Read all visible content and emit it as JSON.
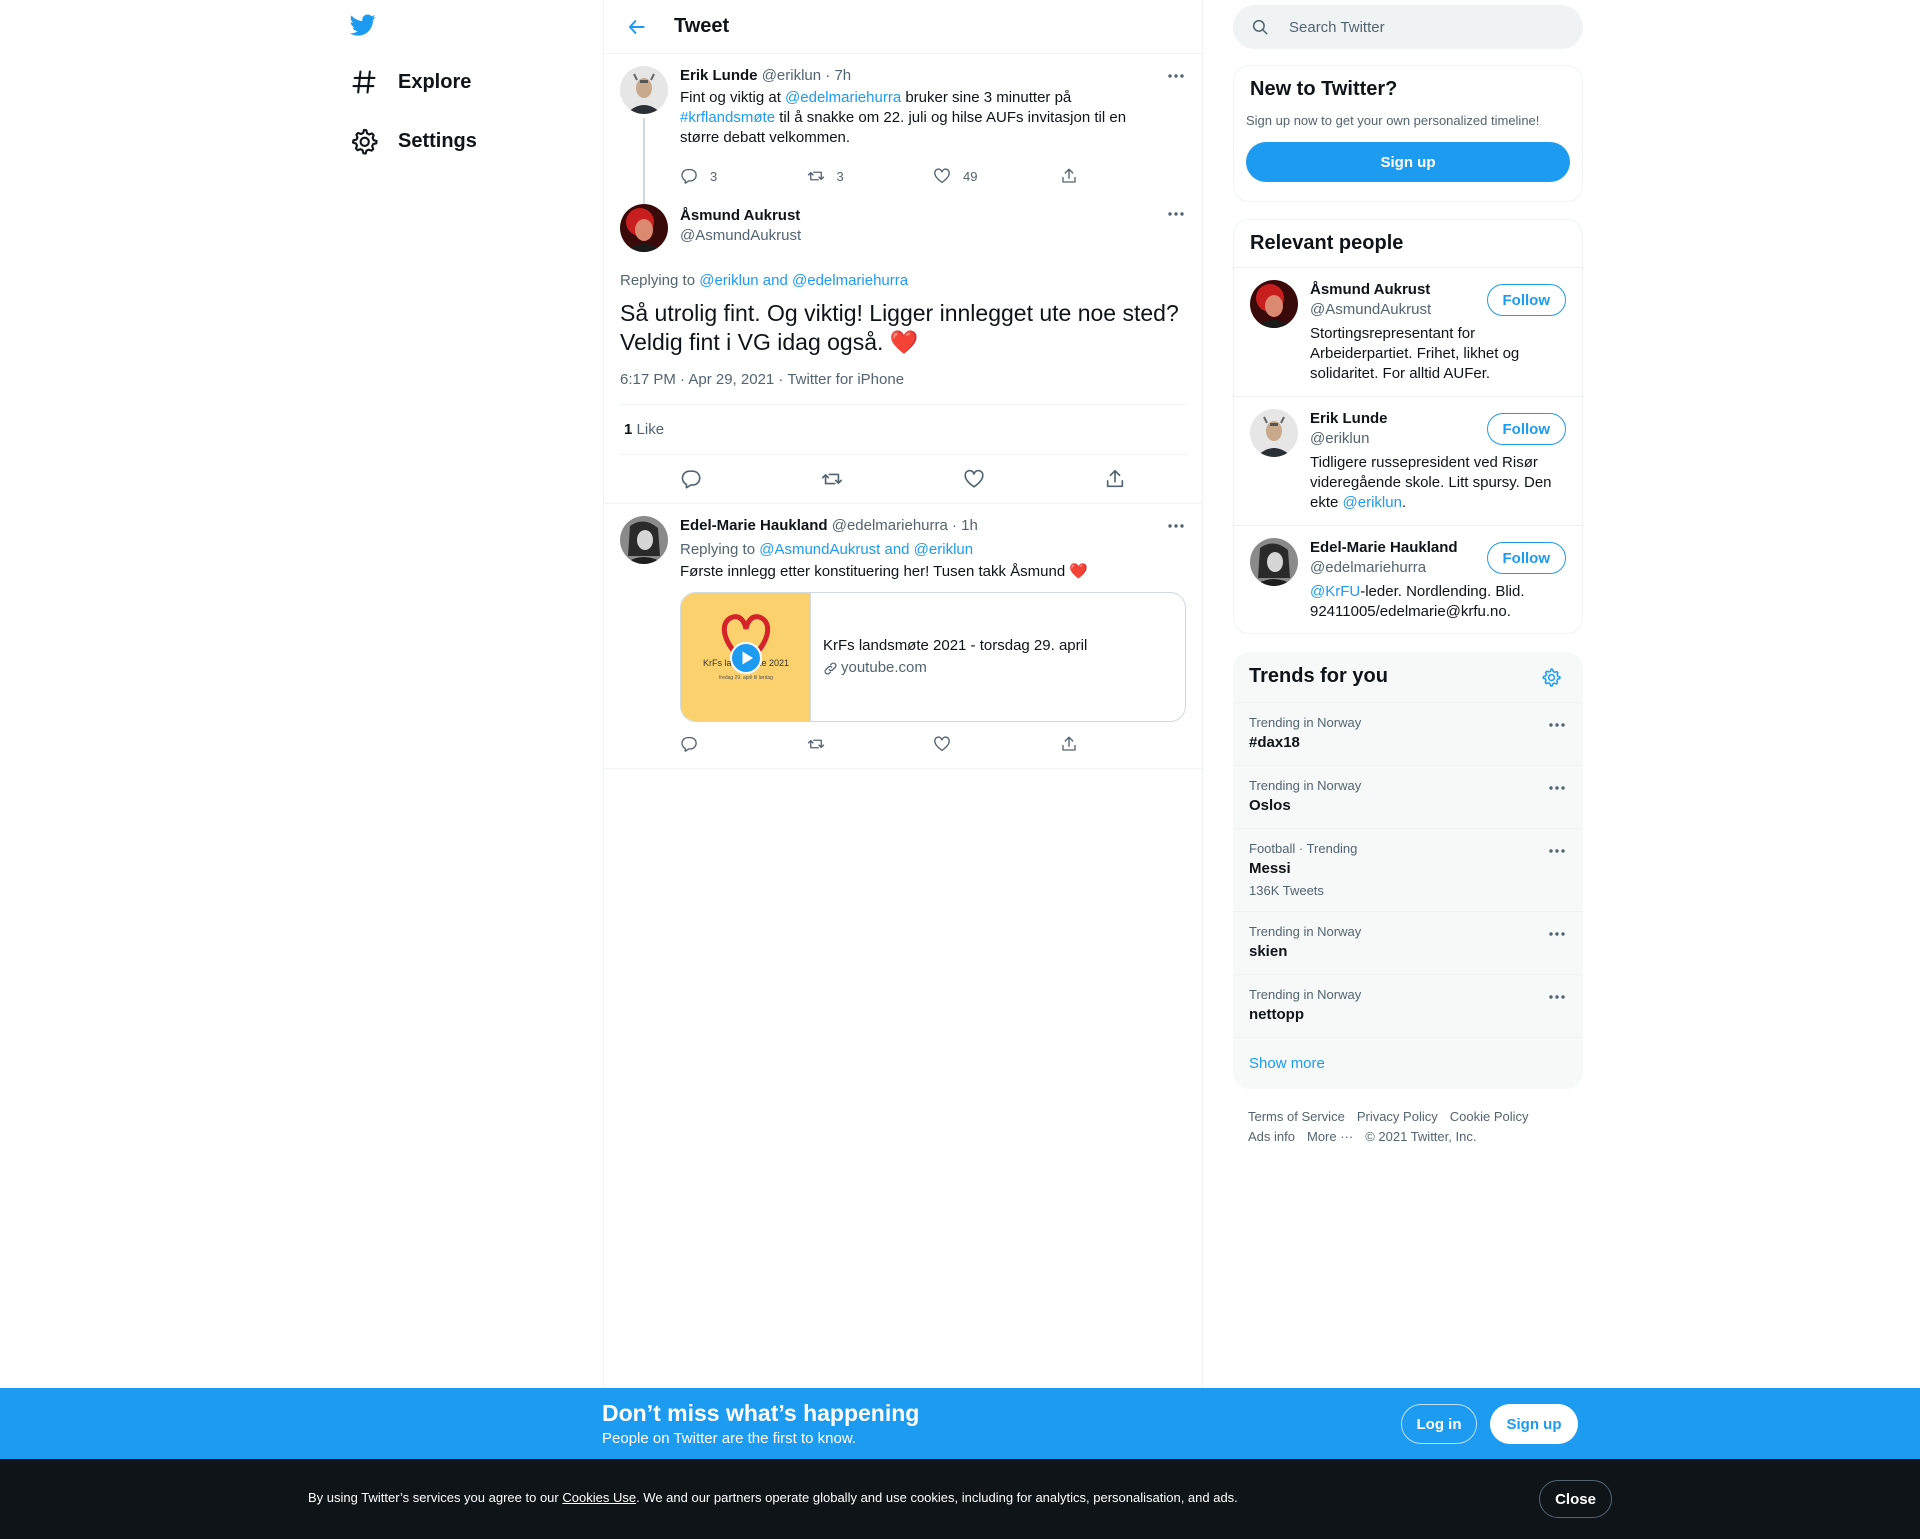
{
  "nav": {
    "items": [
      {
        "label": "Explore"
      },
      {
        "label": "Settings"
      }
    ]
  },
  "header": {
    "title": "Tweet"
  },
  "parent_tweet": {
    "name": "Erik Lunde",
    "handle": "@eriklun",
    "time": "· 7h",
    "text_1": "Fint og viktig at ",
    "mention": "@edelmariehurra",
    "text_2": " bruker sine 3 minutter på ",
    "hashtag": "#krflandsmøte",
    "text_3": " til å snakke om 22. juli og hilse AUFs invitasjon til en større debatt velkommen.",
    "replies": "3",
    "retweets": "3",
    "likes": "49"
  },
  "focus_tweet": {
    "name": "Åsmund Aukrust",
    "handle": "@AsmundAukrust",
    "replying_prefix": "Replying to ",
    "replying_to": "@eriklun and @edelmariehurra",
    "text": "Så utrolig fint. Og viktig! Ligger innlegget ute noe sted? Veldig fint i VG idag også. ",
    "emoji": "❤️",
    "meta": "6:17 PM · Apr 29, 2021 · Twitter for iPhone",
    "like_count": "1",
    "like_label": "Like"
  },
  "reply_tweet": {
    "name": "Edel-Marie Haukland",
    "handle": "@edelmariehurra",
    "time": "· 1h",
    "replying_prefix": "Replying to ",
    "replying_to": "@AsmundAukrust and @eriklun",
    "text": "Første innlegg etter konstituering her! Tusen takk Åsmund ",
    "emoji": "❤️",
    "card": {
      "title": "KrFs landsmøte 2021 - torsdag 29. april",
      "domain": "youtube.com",
      "thumb_title": "KrFs landsmøte 2021",
      "thumb_sub": "fredag 29. april til lørdag"
    }
  },
  "search": {
    "placeholder": "Search Twitter"
  },
  "new_to_twitter": {
    "title": "New to Twitter?",
    "subtitle": "Sign up now to get your own personalized timeline!",
    "button": "Sign up"
  },
  "relevant_people": {
    "title": "Relevant people",
    "follow_label": "Follow",
    "people": [
      {
        "name": "Åsmund Aukrust",
        "handle": "@AsmundAukrust",
        "bio": "Stortingsrepresentant for Arbeiderpartiet. Frihet, likhet og solidaritet. For alltid AUFer."
      },
      {
        "name": "Erik Lunde",
        "handle": "@eriklun",
        "bio_1": "Tidligere russepresident ved Risør videregående skole. Litt spursy. Den ekte ",
        "bio_link": "@eriklun",
        "bio_2": "."
      },
      {
        "name": "Edel-Marie Haukland",
        "handle": "@edelmariehurra",
        "bio_link": "@KrFU",
        "bio_2": "-leder. Nordlending. Blid. 92411005/edelmarie@krfu.no."
      }
    ]
  },
  "trends": {
    "title": "Trends for you",
    "items": [
      {
        "context": "Trending in Norway",
        "name": "#dax18",
        "count": ""
      },
      {
        "context": "Trending in Norway",
        "name": "Oslos",
        "count": ""
      },
      {
        "context": "Football · Trending",
        "name": "Messi",
        "count": "136K Tweets"
      },
      {
        "context": "Trending in Norway",
        "name": "skien",
        "count": ""
      },
      {
        "context": "Trending in Norway",
        "name": "nettopp",
        "count": ""
      }
    ],
    "show_more": "Show more"
  },
  "footer": {
    "terms": "Terms of Service",
    "privacy": "Privacy Policy",
    "cookie": "Cookie Policy",
    "ads": "Ads info",
    "more": "More ···",
    "copyright": "© 2021 Twitter, Inc."
  },
  "bottom_bar": {
    "headline": "Don’t miss what’s happening",
    "sub": "People on Twitter are the first to know.",
    "login": "Log in",
    "signup": "Sign up"
  },
  "cookie_bar": {
    "text_1": "By using Twitter’s services you agree to our ",
    "link": "Cookies Use",
    "text_2": ". We and our partners operate globally and use cookies, including for analytics, personalisation, and ads.",
    "close": "Close"
  },
  "colors": {
    "accent": "#1d9bf0",
    "text": "#0f1419",
    "muted": "#536471",
    "heart": "#e0245e"
  }
}
